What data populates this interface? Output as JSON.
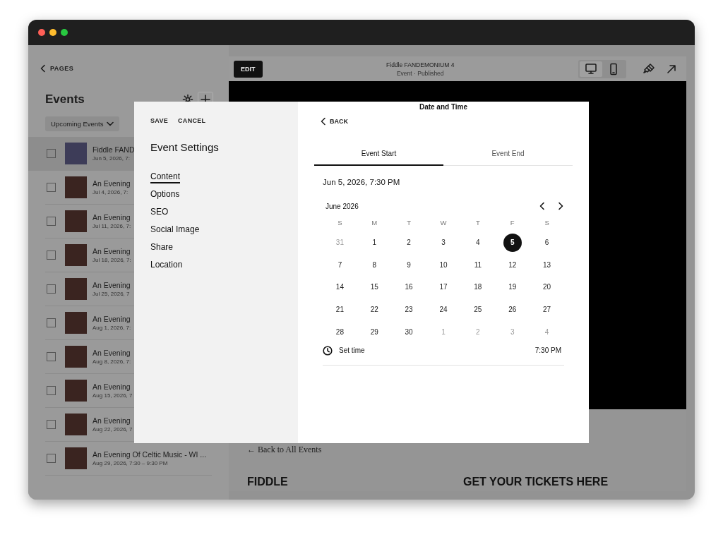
{
  "sidebar": {
    "back": "PAGES",
    "title": "Events",
    "filter": "Upcoming Events",
    "rows": [
      {
        "title": "Fiddle FAND",
        "date": "Jun 5, 2026, 7:",
        "selected": true,
        "checked": false
      },
      {
        "title": "An Evening",
        "date": "Jul 4, 2026, 7:",
        "selected": false,
        "checked": false
      },
      {
        "title": "An Evening",
        "date": "Jul 11, 2026, 7:",
        "selected": false,
        "checked": false
      },
      {
        "title": "An Evening",
        "date": "Jul 18, 2026, 7:",
        "selected": false,
        "checked": false
      },
      {
        "title": "An Evening",
        "date": "Jul 25, 2026, 7",
        "selected": false,
        "checked": false
      },
      {
        "title": "An Evening",
        "date": "Aug 1, 2026, 7:",
        "selected": false,
        "checked": false
      },
      {
        "title": "An Evening",
        "date": "Aug 8, 2026, 7:",
        "selected": false,
        "checked": false
      },
      {
        "title": "An Evening",
        "date": "Aug 15, 2026, 7",
        "selected": false,
        "checked": false
      },
      {
        "title": "An Evening",
        "date": "Aug 22, 2026, 7",
        "selected": false,
        "checked": false
      },
      {
        "title": "An Evening Of Celtic Music - WI ...",
        "date": "Aug 29, 2026, 7:30 – 9:30 PM",
        "selected": false,
        "checked": false
      }
    ]
  },
  "preview": {
    "edit": "EDIT",
    "title": "Fiddle FANDEMONIUM 4",
    "subtitle": "Event · Published",
    "devices": [
      {
        "kind": "desktop",
        "selected": true
      },
      {
        "kind": "mobile",
        "selected": false
      }
    ],
    "back_link": "← Back to All Events",
    "heading_left": "FIDDLE",
    "heading_right": "GET YOUR TICKETS HERE"
  },
  "modal": {
    "actions": [
      "SAVE",
      "CANCEL"
    ],
    "title": "Event Settings",
    "nav": [
      {
        "label": "Content",
        "selected": true
      },
      {
        "label": "Options",
        "selected": false
      },
      {
        "label": "SEO",
        "selected": false
      },
      {
        "label": "Social Image",
        "selected": false
      },
      {
        "label": "Share",
        "selected": false
      },
      {
        "label": "Location",
        "selected": false
      }
    ],
    "panel_title": "Date and Time",
    "back": "BACK",
    "tabs": [
      {
        "label": "Event Start",
        "selected": true
      },
      {
        "label": "Event End",
        "selected": false
      }
    ],
    "value": "Jun 5, 2026, 7:30 PM",
    "month": "June 2026",
    "weekdays": [
      "S",
      "M",
      "T",
      "W",
      "T",
      "F",
      "S"
    ],
    "weeks": [
      [
        {
          "day": "31",
          "outside": true,
          "selected": false
        },
        {
          "day": "1",
          "outside": false,
          "selected": false
        },
        {
          "day": "2",
          "outside": false,
          "selected": false
        },
        {
          "day": "3",
          "outside": false,
          "selected": false
        },
        {
          "day": "4",
          "outside": false,
          "selected": false
        },
        {
          "day": "5",
          "outside": false,
          "selected": true
        },
        {
          "day": "6",
          "outside": false,
          "selected": false
        }
      ],
      [
        {
          "day": "7",
          "outside": false,
          "selected": false
        },
        {
          "day": "8",
          "outside": false,
          "selected": false
        },
        {
          "day": "9",
          "outside": false,
          "selected": false
        },
        {
          "day": "10",
          "outside": false,
          "selected": false
        },
        {
          "day": "11",
          "outside": false,
          "selected": false
        },
        {
          "day": "12",
          "outside": false,
          "selected": false
        },
        {
          "day": "13",
          "outside": false,
          "selected": false
        }
      ],
      [
        {
          "day": "14",
          "outside": false,
          "selected": false
        },
        {
          "day": "15",
          "outside": false,
          "selected": false
        },
        {
          "day": "16",
          "outside": false,
          "selected": false
        },
        {
          "day": "17",
          "outside": false,
          "selected": false
        },
        {
          "day": "18",
          "outside": false,
          "selected": false
        },
        {
          "day": "19",
          "outside": false,
          "selected": false
        },
        {
          "day": "20",
          "outside": false,
          "selected": false
        }
      ],
      [
        {
          "day": "21",
          "outside": false,
          "selected": false
        },
        {
          "day": "22",
          "outside": false,
          "selected": false
        },
        {
          "day": "23",
          "outside": false,
          "selected": false
        },
        {
          "day": "24",
          "outside": false,
          "selected": false
        },
        {
          "day": "25",
          "outside": false,
          "selected": false
        },
        {
          "day": "26",
          "outside": false,
          "selected": false
        },
        {
          "day": "27",
          "outside": false,
          "selected": false
        }
      ],
      [
        {
          "day": "28",
          "outside": false,
          "selected": false
        },
        {
          "day": "29",
          "outside": false,
          "selected": false
        },
        {
          "day": "30",
          "outside": false,
          "selected": false
        },
        {
          "day": "1",
          "outside": true,
          "selected": false
        },
        {
          "day": "2",
          "outside": true,
          "selected": false
        },
        {
          "day": "3",
          "outside": true,
          "selected": false
        },
        {
          "day": "4",
          "outside": true,
          "selected": false
        }
      ]
    ],
    "time_label": "Set time",
    "time_value": "7:30 PM"
  }
}
